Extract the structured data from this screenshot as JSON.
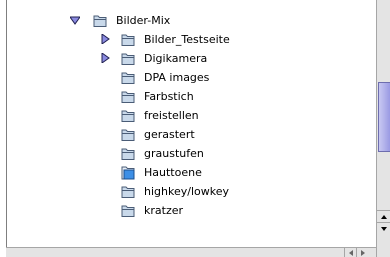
{
  "tree": {
    "items": [
      {
        "label": "Bilder-Mix",
        "level": 0,
        "disclosure": "open",
        "folder_style": "plain"
      },
      {
        "label": "Bilder_Testseite",
        "level": 1,
        "disclosure": "closed",
        "folder_style": "plain"
      },
      {
        "label": "Digikamera",
        "level": 1,
        "disclosure": "closed",
        "folder_style": "plain"
      },
      {
        "label": "DPA images",
        "level": 1,
        "disclosure": "none",
        "folder_style": "plain"
      },
      {
        "label": "Farbstich",
        "level": 1,
        "disclosure": "none",
        "folder_style": "plain"
      },
      {
        "label": "freistellen",
        "level": 1,
        "disclosure": "none",
        "folder_style": "plain"
      },
      {
        "label": "gerastert",
        "level": 1,
        "disclosure": "none",
        "folder_style": "plain"
      },
      {
        "label": "graustufen",
        "level": 1,
        "disclosure": "none",
        "folder_style": "plain"
      },
      {
        "label": "Hauttoene",
        "level": 1,
        "disclosure": "none",
        "folder_style": "open"
      },
      {
        "label": "highkey/lowkey",
        "level": 1,
        "disclosure": "none",
        "folder_style": "plain"
      },
      {
        "label": "kratzer",
        "level": 1,
        "disclosure": "none",
        "folder_style": "plain"
      }
    ]
  },
  "colors": {
    "folder_fill": "#c9d9ea",
    "folder_edge": "#4a5c76",
    "disclosure_fill": "#8a8ae0",
    "scroll_thumb": "#a9a9e8"
  }
}
